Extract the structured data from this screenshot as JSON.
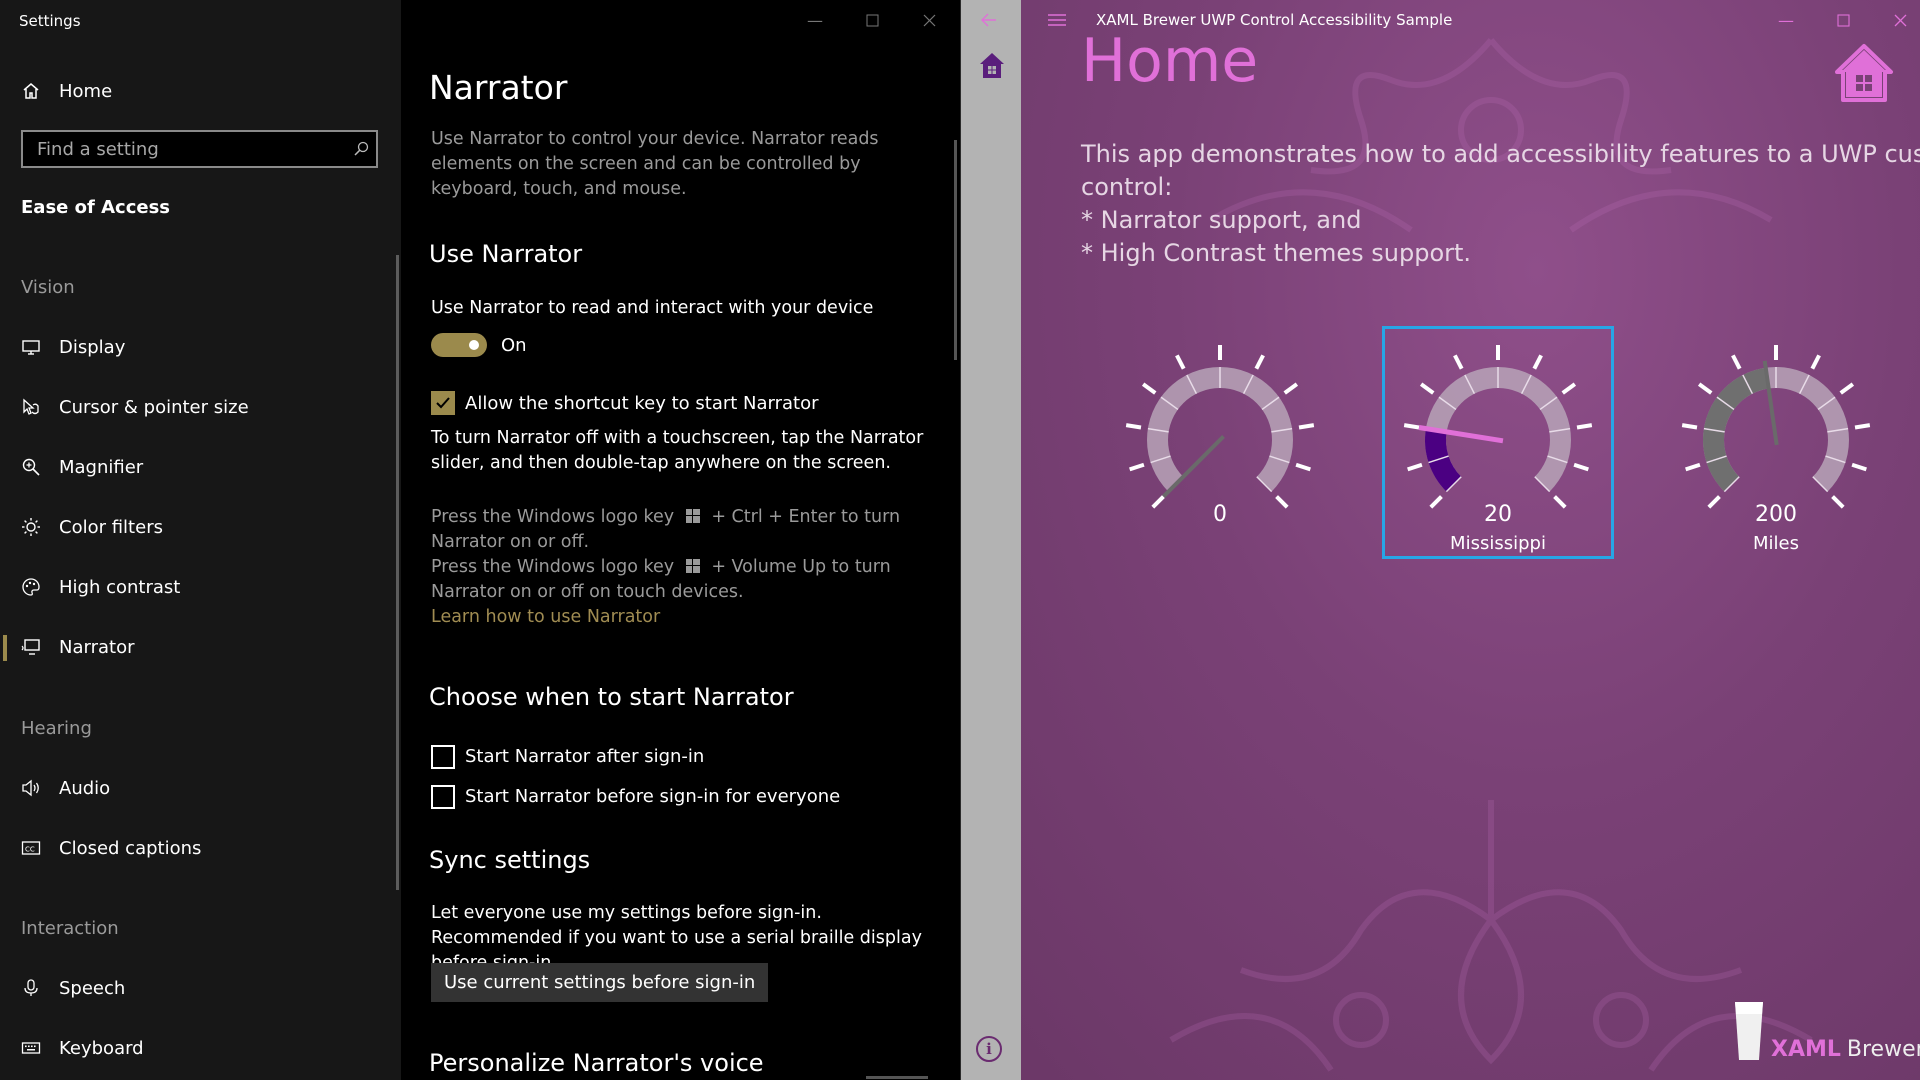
{
  "settings": {
    "app_title": "Settings",
    "nav": {
      "home": "Home",
      "search_placeholder": "Find a setting",
      "section": "Ease of Access",
      "groups": {
        "vision": "Vision",
        "hearing": "Hearing",
        "interaction": "Interaction"
      },
      "items": {
        "display": "Display",
        "cursor": "Cursor & pointer size",
        "magnifier": "Magnifier",
        "color_filters": "Color filters",
        "high_contrast": "High contrast",
        "narrator": "Narrator",
        "audio": "Audio",
        "closed_captions": "Closed captions",
        "speech": "Speech",
        "keyboard": "Keyboard"
      },
      "selected": "narrator"
    },
    "content": {
      "title": "Narrator",
      "intro": "Use Narrator to control your device. Narrator reads elements on the screen and can be controlled by keyboard, touch, and mouse.",
      "use_heading": "Use Narrator",
      "use_label": "Use Narrator to read and interact with your device",
      "toggle_state": "On",
      "shortcut_label": "Allow the shortcut key to start Narrator",
      "shortcut_checked": true,
      "touch_text": "To turn Narrator off with a touchscreen, tap the Narrator slider, and then double-tap anywhere on the screen.",
      "press1_a": "Press the Windows logo key",
      "press1_b": "+ Ctrl + Enter to turn",
      "press1_c": "Narrator on or off.",
      "press2_a": "Press the Windows logo key",
      "press2_b": "+ Volume Up to turn",
      "press2_c": "Narrator on or off on touch devices.",
      "learn_link": "Learn how to use Narrator",
      "choose_heading": "Choose when to start Narrator",
      "after_signin": "Start Narrator after sign-in",
      "before_signin": "Start Narrator before sign-in for everyone",
      "sync_heading": "Sync settings",
      "sync_text": "Let everyone use my settings before sign-in. Recommended if you want to use a serial braille display before sign-in.",
      "sync_button": "Use current settings before sign-in",
      "voice_heading": "Personalize Narrator's voice"
    }
  },
  "sample_app": {
    "title": "XAML Brewer UWP Control Accessibility Sample",
    "page_title": "Home",
    "description": [
      "This app demonstrates how to add accessibility features to a UWP custom",
      "control:",
      "* Narrator support, and",
      "* High Contrast themes support."
    ],
    "gauges": [
      {
        "value": "0",
        "unit": "",
        "fill_fraction": 0.0,
        "focused": false
      },
      {
        "value": "20",
        "unit": "Mississippi",
        "fill_fraction": 0.2,
        "focused": true
      },
      {
        "value": "200",
        "unit": "Miles",
        "fill_fraction": 0.47,
        "focused": false
      }
    ],
    "brand_bold": "XAML",
    "brand_rest": "Brewer",
    "colors": {
      "accent": "#e070d8",
      "background": "#7a4176",
      "gauge_fill_purple": "#4b0082",
      "gauge_fill_gray": "#6f6f6f",
      "focus": "#27a6e6",
      "settings_accent": "#9b8a4c"
    }
  }
}
